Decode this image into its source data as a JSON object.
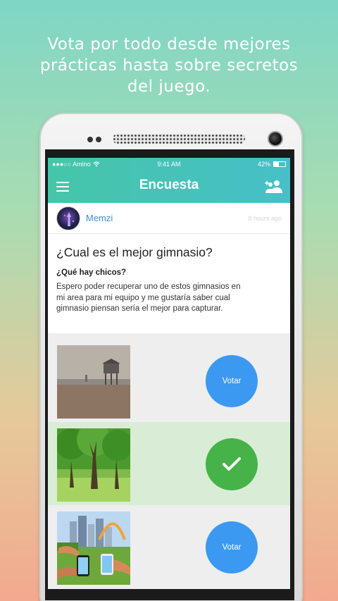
{
  "promo": {
    "line1": "Vota por todo desde mejores",
    "line2": "prácticas hasta sobre secretos",
    "line3": "del juego."
  },
  "status_bar": {
    "carrier": "●●●○○ Amino",
    "time": "9:41 AM",
    "battery": "42%",
    "battery_level": 0.42
  },
  "app_bar": {
    "title": "Encuesta",
    "menu_icon": "hamburger-icon",
    "people_icon": "people-icon"
  },
  "post": {
    "author": "Memzi",
    "time_ago": "8 hours ago",
    "title": "¿Cual es el mejor gimnasio?",
    "subtitle": "¿Qué hay chicos?",
    "body_line1": "Espero poder recuperar uno de estos gimnasios en",
    "body_line2": "mi area para mi equipo y me gustaría saber cual",
    "body_line3": "gimnasio piensan sería el mejor para capturar."
  },
  "options": [
    {
      "button_label": "Votar",
      "selected": false,
      "image": "beach-lifeguard-tower"
    },
    {
      "button_label": "",
      "selected": true,
      "image": "park-trees",
      "icon": "checkmark-icon"
    },
    {
      "button_label": "Votar",
      "selected": false,
      "image": "city-park-phones"
    }
  ],
  "colors": {
    "app_bar": "#45c6a8",
    "vote_blue": "#3b99f1",
    "voted_green": "#45b348",
    "author_link": "#3d8ed8"
  }
}
